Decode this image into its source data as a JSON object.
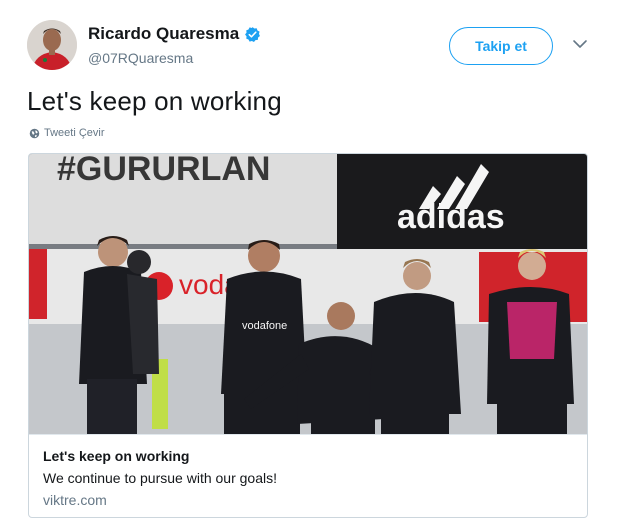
{
  "user": {
    "display_name": "Ricardo Quaresma",
    "handle": "@07RQuaresma",
    "verified": true
  },
  "actions": {
    "follow_label": "Takip et"
  },
  "tweet": {
    "text": "Let's keep on working",
    "translate_label": "Tweeti Çevir"
  },
  "card": {
    "image_text": {
      "banner_left": "#GURURLAN",
      "banner_right": "adidas",
      "ad_board": "vodafone",
      "shirt_sponsor": "vodafone"
    },
    "title": "Let's keep on working",
    "description": "We continue to pursue with our goals!",
    "domain": "viktre.com"
  },
  "colors": {
    "accent": "#1da1f2",
    "text": "#14171a",
    "secondary": "#657786",
    "border": "#ccd6dd"
  },
  "icons": {
    "verified": "verified-badge-icon",
    "caret": "chevron-down-icon",
    "globe": "globe-icon"
  }
}
